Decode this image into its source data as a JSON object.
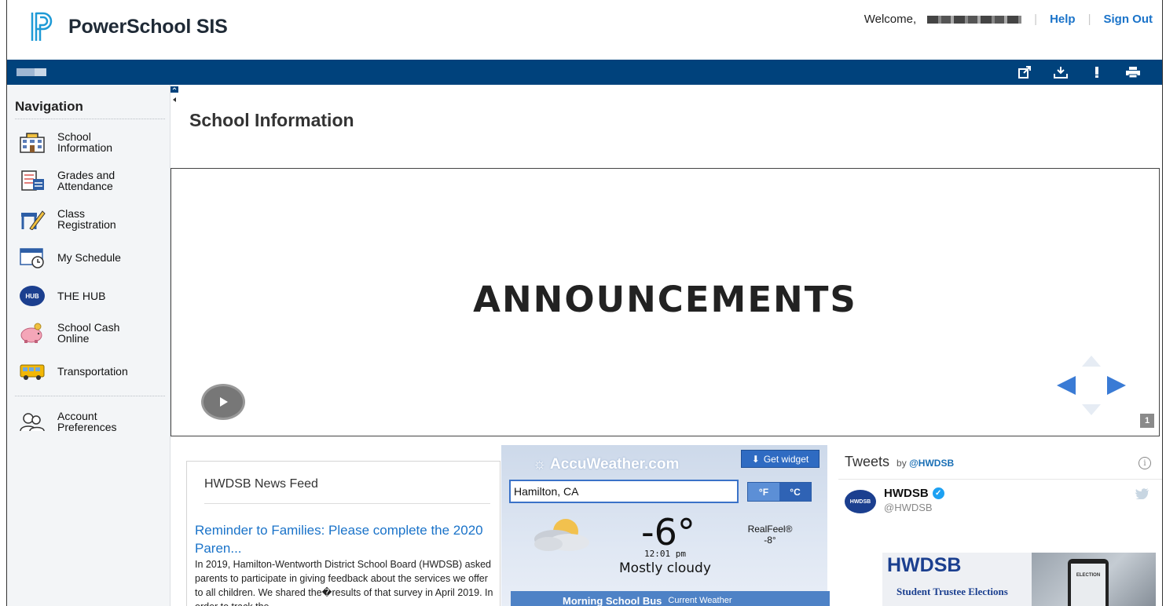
{
  "app": {
    "title": "PowerSchool SIS",
    "welcome": "Welcome,",
    "help": "Help",
    "sign_out": "Sign Out",
    "separator": "|"
  },
  "toolbar": {
    "icons": [
      "external-link-icon",
      "download-icon",
      "alert-icon",
      "print-icon"
    ]
  },
  "sidebar": {
    "title": "Navigation",
    "items": [
      {
        "label": "School Information",
        "icon": "school-building-icon"
      },
      {
        "label": "Grades and Attendance",
        "icon": "gradebook-icon"
      },
      {
        "label": "Class Registration",
        "icon": "desk-pencil-icon"
      },
      {
        "label": "My Schedule",
        "icon": "calendar-clock-icon"
      },
      {
        "label": "THE HUB",
        "icon": "hub-logo-icon",
        "badge": "HUB"
      },
      {
        "label": "School Cash Online",
        "icon": "piggy-bank-icon"
      },
      {
        "label": "Transportation",
        "icon": "school-bus-icon"
      },
      {
        "label": "Account Preferences",
        "icon": "users-gear-icon"
      }
    ]
  },
  "main": {
    "page_title": "School Information",
    "announcements": {
      "title": "ANNOUNCEMENTS",
      "slide_number": "1"
    }
  },
  "news_feed": {
    "title": "HWDSB News Feed",
    "headline": "Reminder to Families: Please complete the 2020 Paren...",
    "body": "In 2019, Hamilton-Wentworth District School Board (HWDSB) asked parents to participate in giving feedback about the services we offer to all children. We shared the\u0000results of that survey in April 2019. In order to track the"
  },
  "weather": {
    "brand": "AccuWeather.com",
    "get_widget": "Get widget",
    "city": "Hamilton, CA",
    "unit_f": "°F",
    "unit_c": "°C",
    "temperature": "-6°",
    "time": "12:01 pm",
    "condition": "Mostly cloudy",
    "realfeel_label": "RealFeel®",
    "realfeel_value": "-8°",
    "bus_title": "Morning School Bus",
    "bus_sub": "Current Weather"
  },
  "tweets": {
    "title": "Tweets",
    "by": "by",
    "handle_link": "@HWDSB",
    "account_name": "HWDSB",
    "account_handle": "@HWDSB",
    "avatar_text": "HWDSB",
    "card_title": "HWDSB",
    "card_subtitle": "Student Trustee Elections",
    "card_phone_text": "ELECTION",
    "info": "i"
  },
  "colors": {
    "brand_blue": "#00427c",
    "link_blue": "#1a73c9"
  }
}
